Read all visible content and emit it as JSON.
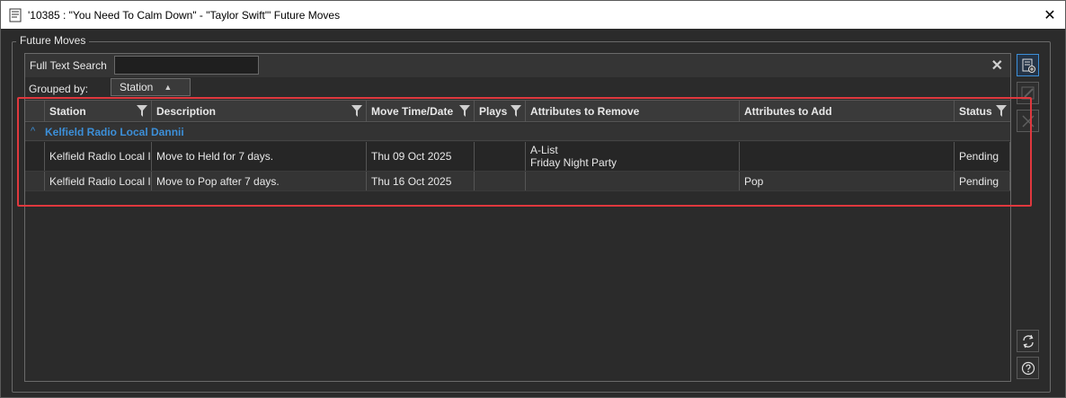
{
  "window": {
    "title": "'10385 : \"You Need To Calm Down\" - \"Taylor Swift\"' Future Moves",
    "close_glyph": "✕"
  },
  "groupbox": {
    "label": "Future Moves"
  },
  "search": {
    "label": "Full Text Search",
    "value": "",
    "clear_glyph": "✕"
  },
  "grouping": {
    "label": "Grouped by:",
    "chip": "Station",
    "sort_glyph": "▲"
  },
  "grid": {
    "columns": [
      "Station",
      "Description",
      "Move Time/Date",
      "Plays",
      "Attributes to Remove",
      "Attributes to Add",
      "Status"
    ],
    "group": {
      "chevron": "^",
      "label": "Kelfield Radio Local Dannii"
    },
    "rows": [
      {
        "station": "Kelfield Radio Local I",
        "description": "Move to Held for 7 days.",
        "move_time": "Thu 09 Oct 2025",
        "plays": "",
        "remove_1": "A-List",
        "remove_2": "Friday Night Party",
        "add": "",
        "status": "Pending"
      },
      {
        "station": "Kelfield Radio Local I",
        "description": "Move to Pop after 7 days.",
        "move_time": "Thu 16 Oct 2025",
        "plays": "",
        "remove_1": "",
        "remove_2": "",
        "add": "Pop",
        "status": "Pending"
      }
    ]
  },
  "side_buttons": [
    {
      "icon": "add-move-icon",
      "state": "active"
    },
    {
      "icon": "edit-icon",
      "state": "disabled"
    },
    {
      "icon": "delete-icon",
      "state": "disabled"
    },
    {
      "icon": "refresh-icon",
      "state": "normal"
    },
    {
      "icon": "help-icon",
      "state": "normal"
    }
  ],
  "colors": {
    "accent": "#3c8fd8",
    "highlight": "#e0383e",
    "background": "#2b2b2b"
  }
}
